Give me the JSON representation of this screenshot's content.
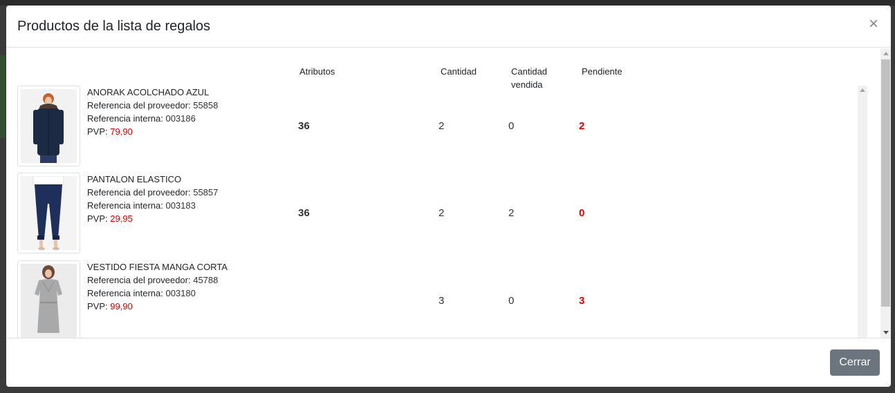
{
  "modal": {
    "title": "Productos de la lista de regalos",
    "close_symbol": "×",
    "close_button_label": "Cerrar"
  },
  "columns": {
    "attributes": "Atributos",
    "quantity": "Cantidad",
    "quantity_sold_line1": "Cantidad",
    "quantity_sold_line2": "vendida",
    "pending": "Pendiente"
  },
  "labels": {
    "supplier_ref": "Referencia del proveedor:",
    "internal_ref": "Referencia interna:",
    "price": "PVP:"
  },
  "products": [
    {
      "name": "ANORAK ACOLCHADO AZUL",
      "supplier_ref": "55858",
      "internal_ref": "003186",
      "price": "79,90",
      "attribute": "36",
      "quantity": "2",
      "sold": "0",
      "pending": "2"
    },
    {
      "name": "PANTALON ELASTICO",
      "supplier_ref": "55857",
      "internal_ref": "003183",
      "price": "29,95",
      "attribute": "36",
      "quantity": "2",
      "sold": "2",
      "pending": "0"
    },
    {
      "name": "VESTIDO FIESTA MANGA CORTA",
      "supplier_ref": "45788",
      "internal_ref": "003180",
      "price": "99,90",
      "attribute": "",
      "quantity": "3",
      "sold": "0",
      "pending": "3"
    }
  ],
  "colors": {
    "price": "#e00000",
    "pending": "#e00000",
    "button": "#6c757d"
  }
}
